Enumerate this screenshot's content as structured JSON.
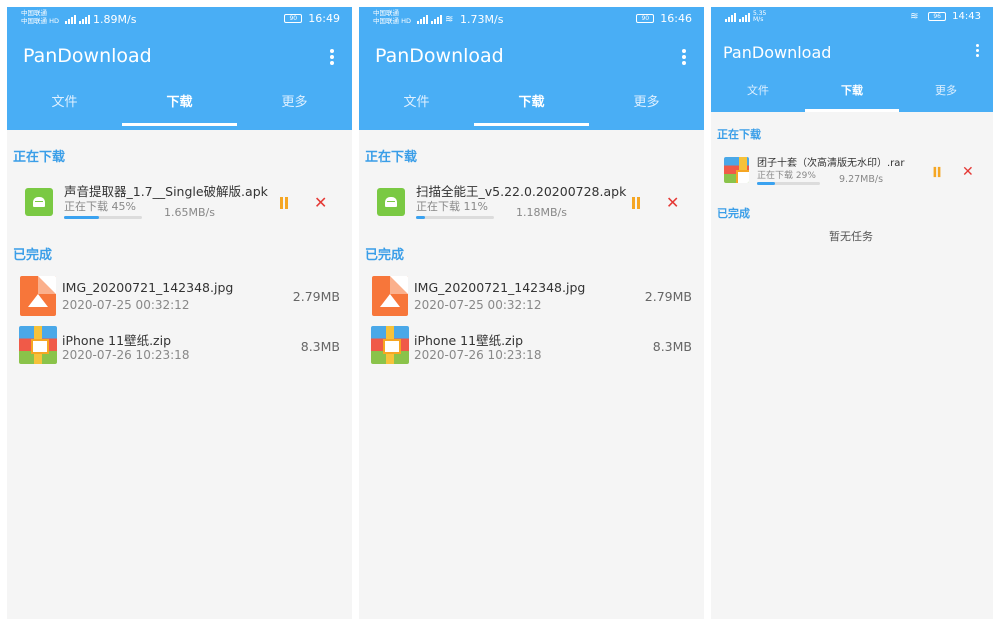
{
  "screens": [
    {
      "status": {
        "carrier1": "中国联通",
        "carrier2": "中国联通 HD",
        "speed": "1.89M/s",
        "time": "16:49",
        "battery": "90"
      },
      "app_title": "PanDownload",
      "tabs": [
        "文件",
        "下载",
        "更多"
      ],
      "active_tab": 1,
      "downloading_label": "正在下载",
      "completed_label": "已完成",
      "downloading": {
        "name": "声音提取器_1.7__Single破解版.apk",
        "status": "正在下载 45%",
        "speed": "1.65MB/s",
        "progress": 0.45
      },
      "completed": [
        {
          "name": "IMG_20200721_142348.jpg",
          "date": "2020-07-25 00:32:12",
          "size": "2.79MB",
          "icon": "image-file-icon"
        },
        {
          "name": "iPhone 11壁纸.zip",
          "date": "2020-07-26 10:23:18",
          "size": "8.3MB",
          "icon": "zip-file-icon"
        }
      ]
    },
    {
      "status": {
        "carrier1": "中国联通",
        "carrier2": "中国联通 HD",
        "speed": "1.73M/s",
        "time": "16:46",
        "battery": "90"
      },
      "app_title": "PanDownload",
      "tabs": [
        "文件",
        "下载",
        "更多"
      ],
      "active_tab": 1,
      "downloading_label": "正在下载",
      "completed_label": "已完成",
      "downloading": {
        "name": "扫描全能王_v5.22.0.20200728.apk",
        "status": "正在下载 11%",
        "speed": "1.18MB/s",
        "progress": 0.11
      },
      "completed": [
        {
          "name": "IMG_20200721_142348.jpg",
          "date": "2020-07-25 00:32:12",
          "size": "2.79MB",
          "icon": "image-file-icon"
        },
        {
          "name": "iPhone 11壁纸.zip",
          "date": "2020-07-26 10:23:18",
          "size": "8.3MB",
          "icon": "zip-file-icon"
        }
      ]
    },
    {
      "status": {
        "speed": "5.35 M/s",
        "time": "14:43",
        "battery": "96"
      },
      "app_title": "PanDownload",
      "tabs": [
        "文件",
        "下载",
        "更多"
      ],
      "active_tab": 1,
      "downloading_label": "正在下载",
      "completed_label": "已完成",
      "downloading": {
        "name": "团子十套（次高清版无水印）.rar",
        "status": "正在下载 29%",
        "speed": "9.27MB/s",
        "progress": 0.29
      },
      "empty_text": "暂无任务"
    }
  ],
  "colors": {
    "appbar": "#49aef5",
    "accent": "#3a9ee8",
    "pause": "#f5a623",
    "cancel": "#e53935"
  }
}
